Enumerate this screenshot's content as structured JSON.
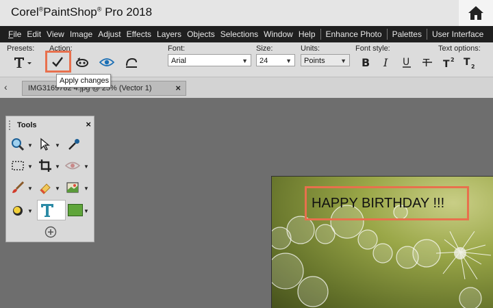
{
  "app": {
    "title_brand": "Corel",
    "title_mid": "PaintShop",
    "title_tail": "Pro 2018",
    "reg": "®"
  },
  "menu": {
    "items": [
      "File",
      "Edit",
      "View",
      "Image",
      "Adjust",
      "Effects",
      "Layers",
      "Objects",
      "Selections",
      "Window",
      "Help",
      "Enhance Photo",
      "Palettes",
      "User Interface"
    ]
  },
  "toolbar": {
    "presets_label": "Presets:",
    "action_label": "Action:",
    "font_label": "Font:",
    "font_value": "Arial",
    "size_label": "Size:",
    "size_value": "24",
    "units_label": "Units:",
    "units_value": "Points",
    "fontstyle_label": "Font style:",
    "textoptions_label": "Text options:",
    "tooltip": "Apply changes"
  },
  "tab": {
    "name": "IMG3169782 4.jpg @ 25% (Vector 1)"
  },
  "tools": {
    "title": "Tools",
    "close": "×"
  },
  "canvas": {
    "text": "HAPPY BIRTHDAY !!!"
  },
  "colors": {
    "highlight": "#e8704d",
    "menubar": "#1f1f1f",
    "workspace": "#6e6e6e",
    "foreground_swatch": "#5fa53a"
  }
}
